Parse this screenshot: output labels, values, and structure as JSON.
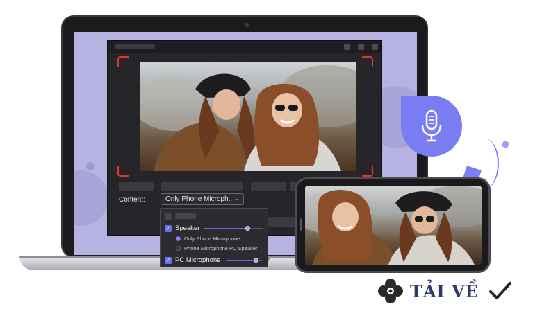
{
  "app": {
    "content_label": "Content:",
    "content_value": "Only Phone Microph...",
    "chevron": "⌄"
  },
  "audio_menu": {
    "speaker_label": "Speaker",
    "speaker_volume": 0.75,
    "option_only_phone": "Only Phone Microphone",
    "option_phone_pc": "Phone Microphone PC Speaker",
    "pc_mic_label": "PC Microphone",
    "pc_mic_volume": 0.85,
    "check_glyph": "✓"
  },
  "watermark": {
    "text": "TẢI VỀ"
  },
  "colors": {
    "accent": "#7a7df1",
    "record_corner": "#e2352e",
    "screen_bg": "#b6b2e2"
  },
  "icons": {
    "mic": "microphone-icon",
    "watermark_logo": "clover-icon",
    "watermark_check": "checkmark-icon"
  }
}
